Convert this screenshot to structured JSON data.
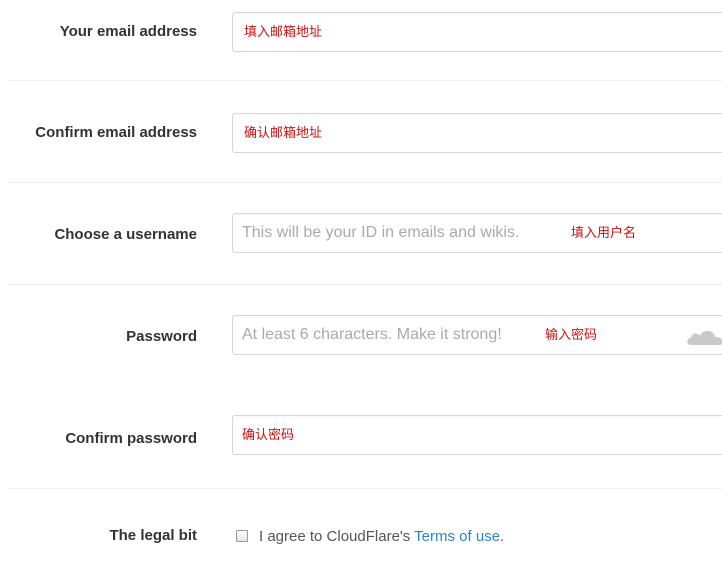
{
  "form": {
    "email": {
      "label": "Your email address",
      "placeholder": "",
      "annotation": "填入邮箱地址"
    },
    "confirm_email": {
      "label": "Confirm email address",
      "placeholder": "",
      "annotation": "确认邮箱地址"
    },
    "username": {
      "label": "Choose a username",
      "placeholder": "This will be your ID in emails and wikis.",
      "annotation": "填入用户名"
    },
    "password": {
      "label": "Password",
      "placeholder": "At least 6 characters. Make it strong!",
      "annotation": "输入密码",
      "strength_icon": "cloud-icon"
    },
    "confirm_password": {
      "label": "Confirm password",
      "placeholder": "",
      "annotation": "确认密码"
    },
    "legal": {
      "label": "The legal bit",
      "checked": false,
      "agree_prefix": "I agree to CloudFlare's ",
      "terms_link": "Terms of use",
      "agree_suffix": "."
    }
  },
  "colors": {
    "annotation": "#d01010",
    "link": "#2a86c8",
    "label": "#333333",
    "placeholder": "#aaaaaa"
  }
}
